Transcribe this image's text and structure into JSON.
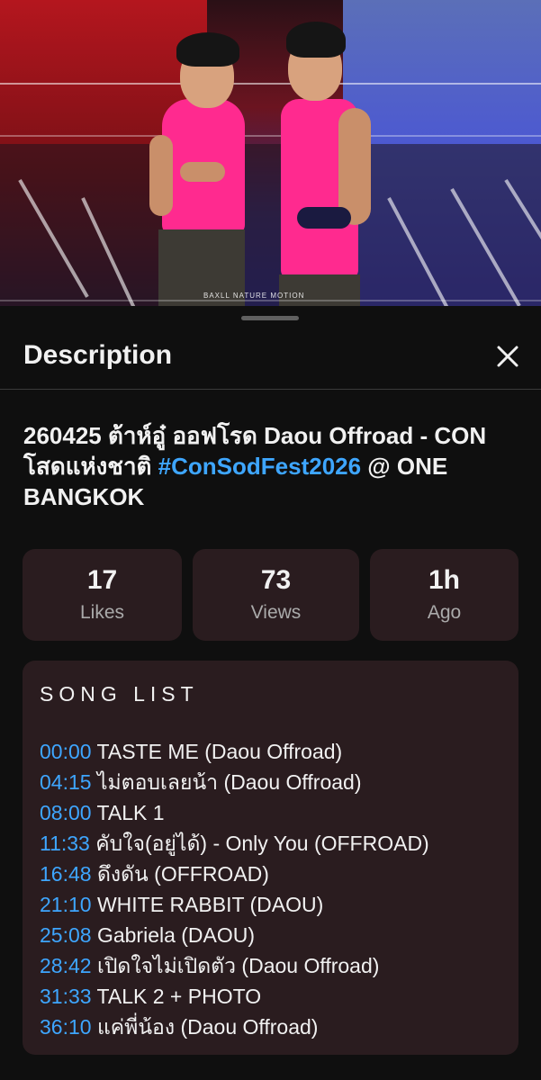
{
  "video": {
    "watermark": "BAXLL NATURE MOTION"
  },
  "sheet": {
    "title": "Description",
    "close_icon": "close-icon"
  },
  "video_title": {
    "part1": "260425 ต้าห์อู๋ ออฟโรด Daou Offroad - CON โสดแห่งชาติ ",
    "hashtag": "#ConSodFest2026",
    "part2": " @ ONE BANGKOK"
  },
  "stats": [
    {
      "value": "17",
      "label": "Likes"
    },
    {
      "value": "73",
      "label": "Views"
    },
    {
      "value": "1h",
      "label": "Ago"
    }
  ],
  "song_list": {
    "heading": "SONG LIST",
    "items": [
      {
        "time": "00:00",
        "title": " TASTE ME (Daou Offroad)"
      },
      {
        "time": "04:15",
        "title": " ไม่ตอบเลยน้า (Daou Offroad)"
      },
      {
        "time": "08:00",
        "title": " TALK 1"
      },
      {
        "time": "11:33",
        "title": " คับใจ(อยู่ได้) - Only You (OFFROAD)"
      },
      {
        "time": "16:48",
        "title": " ดึงดัน (OFFROAD)"
      },
      {
        "time": "21:10",
        "title": " WHITE RABBIT (DAOU)"
      },
      {
        "time": "25:08",
        "title": " Gabriela (DAOU)"
      },
      {
        "time": "28:42",
        "title": " เปิดใจไม่เปิดตัว (Daou Offroad)"
      },
      {
        "time": "31:33",
        "title": " TALK 2 + PHOTO"
      },
      {
        "time": "36:10",
        "title": " แค่พี่น้อง (Daou Offroad)"
      }
    ]
  },
  "colors": {
    "link": "#3ea6ff",
    "card": "#2a1c1f",
    "background": "#0f0f0f"
  }
}
